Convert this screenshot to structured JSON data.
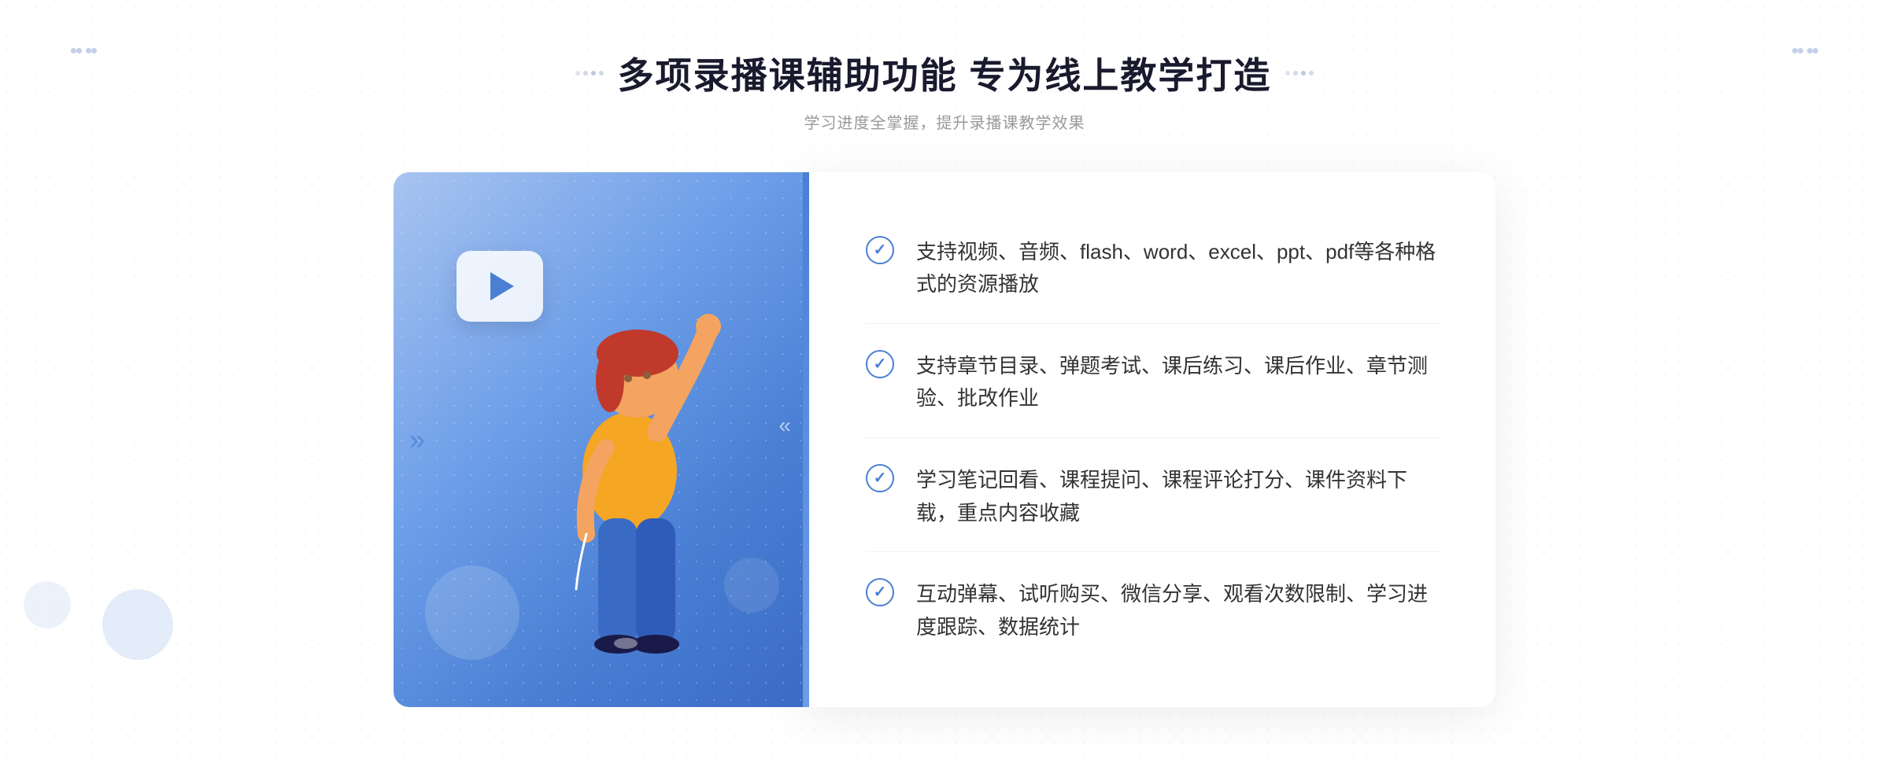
{
  "header": {
    "title": "多项录播课辅助功能 专为线上教学打造",
    "subtitle": "学习进度全掌握，提升录播课教学效果"
  },
  "features": [
    {
      "id": "feature-1",
      "text": "支持视频、音频、flash、word、excel、ppt、pdf等各种格式的资源播放"
    },
    {
      "id": "feature-2",
      "text": "支持章节目录、弹题考试、课后练习、课后作业、章节测验、批改作业"
    },
    {
      "id": "feature-3",
      "text": "学习笔记回看、课程提问、课程评论打分、课件资料下载，重点内容收藏"
    },
    {
      "id": "feature-4",
      "text": "互动弹幕、试听购买、微信分享、观看次数限制、学习进度跟踪、数据统计"
    }
  ],
  "decorations": {
    "chevron_symbol": "》",
    "check_symbol": "✓"
  }
}
